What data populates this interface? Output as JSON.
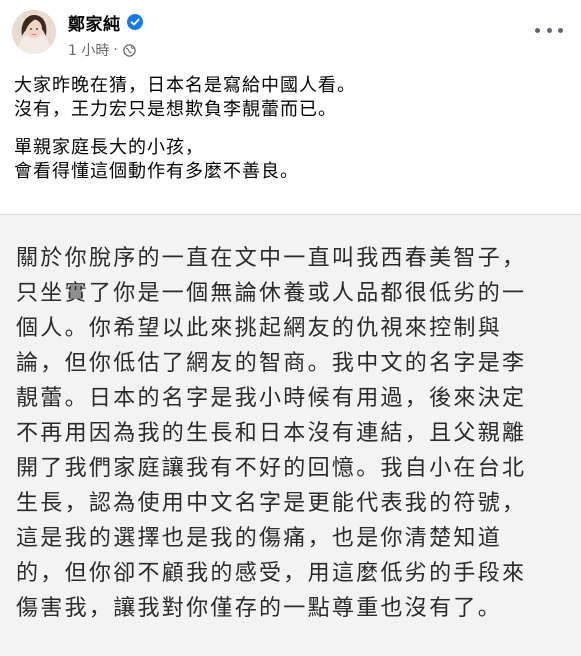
{
  "post": {
    "author": {
      "name": "鄭家純",
      "verified": true
    },
    "meta": {
      "timestamp": "1 小時",
      "separator": "·",
      "privacy_icon": "globe-icon"
    },
    "more_icon": "more-horizontal-icon",
    "text": {
      "paragraph1": [
        "大家昨晚在猜，日本名是寫給中國人看。",
        "沒有，王力宏只是想欺負李靚蕾而已。"
      ],
      "paragraph2": [
        "單親家庭長大的小孩，",
        "會看得懂這個動作有多麼不善良。"
      ]
    },
    "image": {
      "lines": [
        "關於你脫序的一直在文中一直叫我西春美智子，",
        "只坐實了你是一個無論休養或人品都很低劣的一",
        "個人。你希望以此來挑起網友的仇視來控制與",
        "論，但你低估了網友的智商。我中文的名字是李",
        "靚蕾。日本的名字是我小時候有用過，後來決定",
        "不再用因為我的生長和日本沒有連結，且父親離",
        "開了我們家庭讓我有不好的回憶。我自小在台北",
        "生長，認為使用中文名字是更能代表我的符號，",
        "這是我的選擇也是我的傷痛，也是你清楚知道",
        "的，但你卻不顧我的感受，用這麼低劣的手段來",
        "傷害我，讓我對你僅存的一點尊重也沒有了。"
      ]
    },
    "colors": {
      "verified_badge": "#1877f2",
      "meta_text": "#65676b",
      "image_background": "#f3f3f3"
    }
  }
}
